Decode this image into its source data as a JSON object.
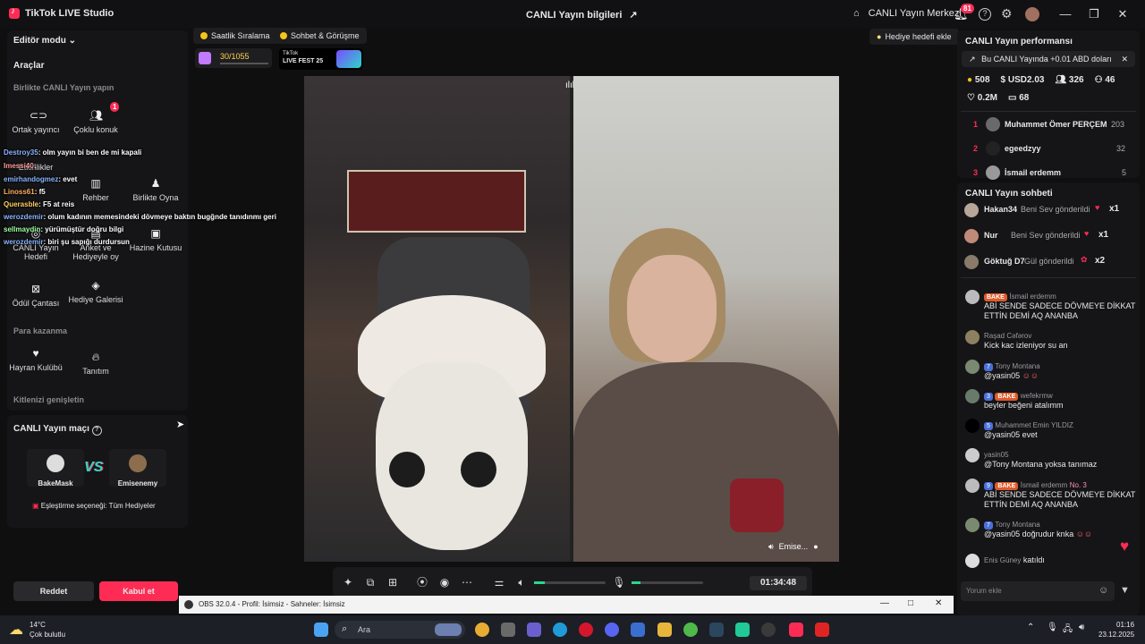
{
  "titlebar": {
    "app_name": "TikTok LIVE Studio",
    "center_title": "CANLI Yayın bilgileri",
    "live_center": "CANLI Yayın Merkezi",
    "notif_count": "81"
  },
  "left": {
    "editor_mode": "Editör modu",
    "tools_title": "Araçlar",
    "collab_label": "Birlikte CANLI Yayın yapın",
    "tools": [
      {
        "label": "Ortak yayıncı"
      },
      {
        "label": "Çoklu konuk",
        "badge": "1"
      },
      {
        "label": "Etkinlikler"
      },
      {
        "label": "Rehber"
      },
      {
        "label": "Birlikte Oyna"
      },
      {
        "label": "CANLI Yayın Hedefi"
      },
      {
        "label": "Anket ve Hediyeyle oy"
      },
      {
        "label": "Hazine Kutusu"
      },
      {
        "label": "Ödül Çantası"
      },
      {
        "label": "Hediye Galerisi"
      }
    ],
    "money_label": "Para kazanma",
    "money_tools": [
      {
        "label": "Hayran Kulübü"
      },
      {
        "label": "Tanıtım"
      }
    ],
    "expand_label": "Kitlenizi genişletin",
    "match_title": "CANLI Yayın maçı",
    "match_p1": "BakeMask",
    "match_p2": "Emisenemy",
    "match_vs": "VS",
    "match_option": "Eşleştirme seçeneği: Tüm Hediyeler",
    "reject": "Reddet",
    "accept": "Kabul et"
  },
  "overlay_chat": [
    {
      "user": "Destroy35",
      "text": ": olm yayın bi ben de mi kapali"
    },
    {
      "user": "Imessi40",
      "text": ":"
    },
    {
      "user": "emirhandogmez",
      "text": ": evet"
    },
    {
      "user": "Linoss61",
      "text": ": f5"
    },
    {
      "user": "Querasble",
      "text": ": F5 at reis"
    },
    {
      "user": "werozdemir",
      "text": ": olum kadının memesindeki dövmeye baktın bugğnde tanıdınmı geri"
    },
    {
      "user": "sellmaydin",
      "text": ": yürümüştür doğru bilgi"
    },
    {
      "user": "werozdemir",
      "text": ": biri şu sapığı durdursun"
    }
  ],
  "center": {
    "pill1": "Saatlik Sıralama",
    "pill2": "Sohbet & Görüşme",
    "gift_goal": "Hediye hedefi ekle",
    "score": "30/1055",
    "fest_line1": "TikTok",
    "fest_line2": "LIVE FEST 25",
    "guest_name": "Emise...",
    "timer": "01:34:48"
  },
  "right": {
    "perf_title": "CANLI Yayın performansı",
    "earn_banner": "Bu CANLI Yayında +0.01 ABD doları",
    "stats": {
      "coins": "508",
      "usd": "USD2.03",
      "viewers": "326",
      "guests": "46",
      "likes": "0.2M",
      "comments": "68"
    },
    "ranking": [
      {
        "rank": "1",
        "name": "Muhammet Ömer PERÇEM",
        "score": "203"
      },
      {
        "rank": "2",
        "name": "egeedzyy",
        "score": "32"
      },
      {
        "rank": "3",
        "name": "İsmail erdemm",
        "score": "5"
      }
    ],
    "chat_title": "CANLI Yayın sohbeti",
    "gifts": [
      {
        "user": "Hakan34",
        "action": "Beni Sev gönderildi",
        "count": "x1"
      },
      {
        "user": "Nur",
        "action": "Beni Sev gönderildi",
        "count": "x1"
      },
      {
        "user": "Göktuğ D7",
        "action": "Gül gönderildi",
        "count": "x2"
      }
    ],
    "messages": [
      {
        "badge": "BAKE",
        "name": "İsmail erdemm",
        "text": "ABİ SENDE SADECE DÖVMEYE DİKKAT ETTİN DEMİ AQ ANANBA"
      },
      {
        "name": "Raşad Cəfərov",
        "text": "Kick kac izleniyor su an"
      },
      {
        "level": "7",
        "name": "Tony Montana",
        "text": "@yasin05"
      },
      {
        "level": "3",
        "badge": "BAKE",
        "name": "wefekrmw",
        "text": "beyler beğeni atalımm"
      },
      {
        "level": "5",
        "name": "Muhammet Emin YILDIZ",
        "text": "@yasin05 evet"
      },
      {
        "name": "yasin05",
        "text": "@Tony Montana yoksa tanımaz"
      },
      {
        "level": "9",
        "badge": "BAKE",
        "name": "İsmail erdemm",
        "extra": "No. 3",
        "text": "ABİ SENDE SADECE DÖVMEYE DİKKAT ETTİN DEMİ AQ ANANBA"
      },
      {
        "level": "7",
        "name": "Tony Montana",
        "text": "@yasin05 doğrudur knka"
      },
      {
        "name": "Enis Güney",
        "text": "katıldı"
      }
    ],
    "comment_placeholder": "Yorum ekle"
  },
  "obs": {
    "title": "OBS 32.0.4 - Profil: İsimsiz - Sahneler: İsimsiz"
  },
  "taskbar": {
    "temp": "14°C",
    "weather": "Çok bulutlu",
    "search": "Ara",
    "time": "01:16",
    "date": "23.12.2025"
  },
  "colors": {
    "accent": "#fe2c55",
    "bg": "#0f0f10",
    "panel": "#151517"
  }
}
